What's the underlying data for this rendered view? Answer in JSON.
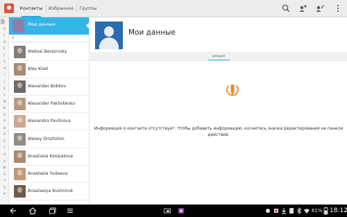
{
  "tabs": [
    {
      "label": "Контакты",
      "active": true
    },
    {
      "label": "Избранное",
      "active": false
    },
    {
      "label": "Группы",
      "active": false
    }
  ],
  "actions": [
    "search-icon",
    "add-contact-icon",
    "edit-contact-icon",
    "overflow-menu-icon"
  ],
  "alphabet": [
    "А",
    "B",
    "C",
    "D",
    "E",
    "F",
    "G",
    "H",
    "I",
    "J",
    "K",
    "L",
    "M",
    "N",
    "O",
    "P",
    "Q",
    "R",
    "S",
    "T",
    "U",
    "V",
    "W",
    "X",
    "Y",
    "Z",
    "#"
  ],
  "me": {
    "name": "Мои данные"
  },
  "section_letter": "A",
  "contacts": [
    {
      "name": "Aleksei Bereznisky"
    },
    {
      "name": "Alex Kisel"
    },
    {
      "name": "Alexander Bobkov"
    },
    {
      "name": "Alexander Pakhotenko"
    },
    {
      "name": "Alexandra Pavlinova"
    },
    {
      "name": "Alexey Drozhzhin"
    },
    {
      "name": "Anastasia Kosipatova"
    },
    {
      "name": "Anastasia Yudaeva"
    },
    {
      "name": "Anastasiya Kushniruk"
    }
  ],
  "detail": {
    "title": "Мои данные",
    "tab_label": "рмация",
    "empty_message": "Информация о контакте отсутствует. Чтобы добавить информацию, коснитесь значка редактирования на панели действий."
  },
  "status": {
    "battery": "61%",
    "time": "18:12"
  },
  "colors": {
    "accent": "#33b5e5",
    "edit_icon": "#f08a1c"
  }
}
